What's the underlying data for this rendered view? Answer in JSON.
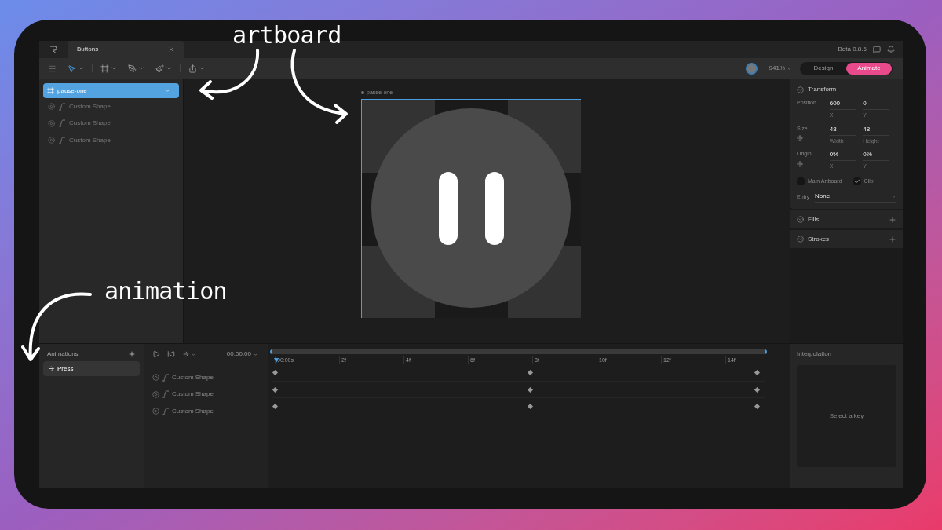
{
  "title_bar": {
    "tab": {
      "label": "Buttons"
    },
    "version": "Beta 0.8.6"
  },
  "toolbar": {
    "zoom": "941%",
    "modes": [
      {
        "label": "Design",
        "selected": false
      },
      {
        "label": "Animate",
        "selected": true
      }
    ]
  },
  "layers": {
    "artboard": {
      "name": "pause-one",
      "selected": true
    },
    "children": [
      {
        "name": "Custom Shape"
      },
      {
        "name": "Custom Shape"
      },
      {
        "name": "Custom Shape"
      }
    ]
  },
  "canvas": {
    "artboard_label": "pause-one"
  },
  "inspector": {
    "title": "Transform",
    "rows": [
      {
        "label": "Position",
        "fields": [
          {
            "value": "600",
            "caption": "X"
          },
          {
            "value": "0",
            "caption": "Y"
          }
        ]
      },
      {
        "label": "Size",
        "fields": [
          {
            "value": "48",
            "caption": "Width"
          },
          {
            "value": "48",
            "caption": "Height"
          }
        ]
      },
      {
        "label": "Origin",
        "fields": [
          {
            "value": "0%",
            "caption": "X"
          },
          {
            "value": "0%",
            "caption": "Y"
          }
        ]
      }
    ],
    "checks": [
      {
        "label": "Main Artboard",
        "checked": false
      },
      {
        "label": "Clip",
        "checked": true
      }
    ],
    "entry": {
      "label": "Entry",
      "value": "None"
    },
    "sections": [
      {
        "title": "Fills"
      },
      {
        "title": "Strokes"
      }
    ]
  },
  "animations": {
    "title": "Animations",
    "items": [
      {
        "name": "Press",
        "selected": true
      }
    ]
  },
  "timeline": {
    "time": "00:00:00",
    "ticks": [
      "00:00s",
      "2f",
      "4f",
      "6f",
      "8f",
      "10f",
      "12f",
      "14f"
    ],
    "tracks": [
      {
        "name": "Custom Shape",
        "keyframes": [
          {
            "level": 0
          },
          {
            "level": 0.53
          },
          {
            "level": 1
          }
        ]
      },
      {
        "name": "Custom Shape",
        "keyframes": [
          {
            "level": 0
          },
          {
            "level": 0.53
          },
          {
            "level": 1
          }
        ]
      },
      {
        "name": "Custom Shape",
        "keyframes": [
          {
            "level": 0
          },
          {
            "level": 0.53
          },
          {
            "level": 1
          }
        ]
      }
    ]
  },
  "interpolation": {
    "title": "Interpolation",
    "empty_text": "Select a key"
  },
  "annotations": [
    {
      "text": "artboard"
    },
    {
      "text": "animation"
    }
  ]
}
